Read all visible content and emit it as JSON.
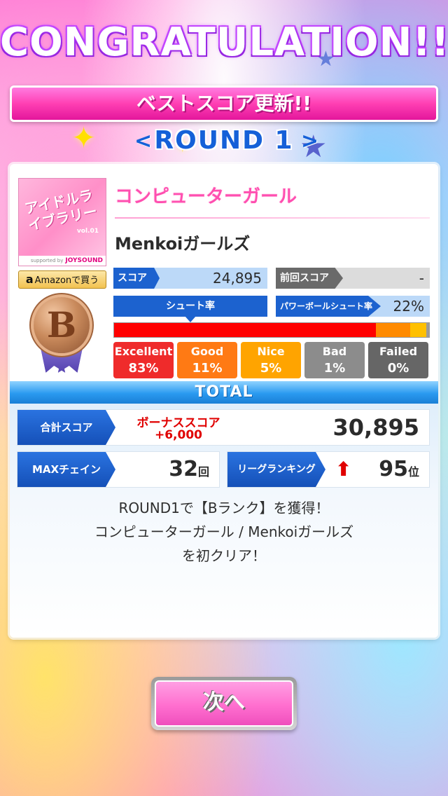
{
  "header": {
    "title": "CONGRATULATION!!",
    "best_score_banner": "ベストスコア更新!!",
    "round_label": "ROUND 1",
    "prev_arrow": "<",
    "next_arrow": ">"
  },
  "song": {
    "album_title": "アイドルライブラリー",
    "album_vol": "vol.01",
    "album_sponsor": "supported by",
    "album_brand": "JOYSOUND",
    "amazon_logo": "a",
    "amazon_label": "Amazonで買う",
    "title": "コンピューターガール",
    "artist": "Menkoiガールズ",
    "rank_letter": "B"
  },
  "stats": {
    "score_label": "スコア",
    "score_value": "24,895",
    "prev_score_label": "前回スコア",
    "prev_score_value": "-",
    "shoot_rate_label": "シュート率",
    "power_shoot_label": "パワーボールシュート率",
    "power_shoot_value": "22%"
  },
  "progress": {
    "segments": [
      {
        "name": "excellent",
        "fraction": 0.83,
        "color": "#ff0000"
      },
      {
        "name": "good",
        "fraction": 0.11,
        "color": "#ff8a00"
      },
      {
        "name": "nice",
        "fraction": 0.05,
        "color": "#ffc000"
      },
      {
        "name": "bad",
        "fraction": 0.01,
        "color": "#9a9a9a"
      }
    ]
  },
  "judgements": [
    {
      "label": "Excellent",
      "value": "83%",
      "color": "#ef2b2b"
    },
    {
      "label": "Good",
      "value": "11%",
      "color": "#ff7a14"
    },
    {
      "label": "Nice",
      "value": "5%",
      "color": "#ffa400"
    },
    {
      "label": "Bad",
      "value": "1%",
      "color": "#8c8c8c"
    },
    {
      "label": "Failed",
      "value": "0%",
      "color": "#666666"
    }
  ],
  "total": {
    "header": "TOTAL",
    "total_score_label": "合計スコア",
    "bonus_label": "ボーナススコア",
    "bonus_value": "+6,000",
    "total_score_value": "30,895",
    "max_chain_label": "MAXチェイン",
    "max_chain_value": "32",
    "max_chain_unit": "回",
    "league_ranking_label": "リーグランキング",
    "league_ranking_arrow": "⬆",
    "league_ranking_value": "95",
    "league_ranking_unit": "位"
  },
  "message": {
    "line1": "ROUND1で【Bランク】を獲得！",
    "line2": "コンピューターガール / Menkoiガールズ",
    "line3": "を初クリア！"
  },
  "footer": {
    "next_button": "次へ"
  }
}
